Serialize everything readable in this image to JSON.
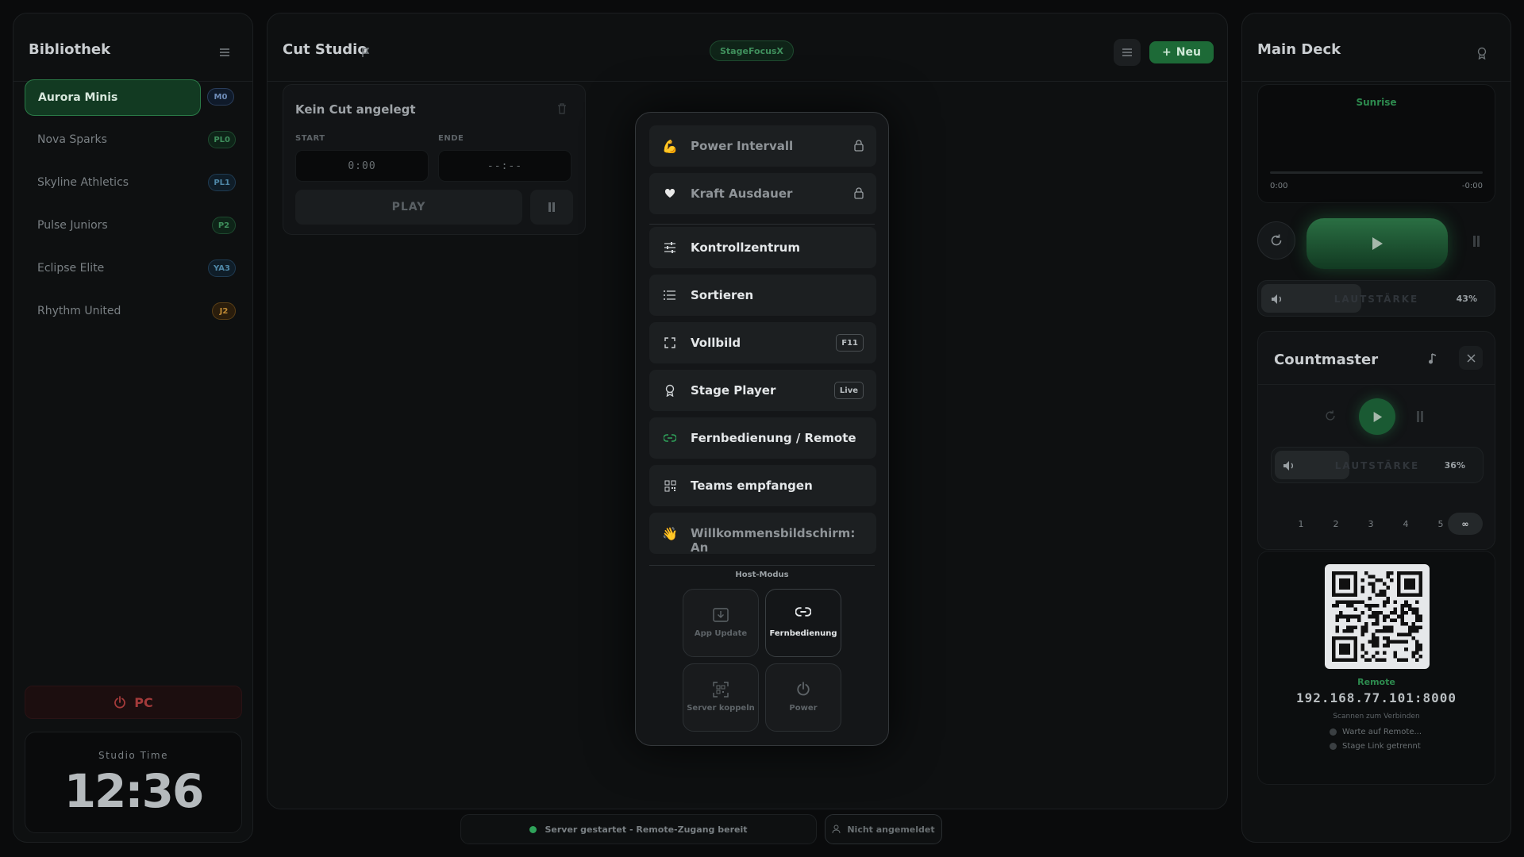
{
  "library": {
    "title": "Bibliothek",
    "items": [
      {
        "name": "Aurora Minis",
        "badge": "M0"
      },
      {
        "name": "Nova Sparks",
        "badge": "PL0"
      },
      {
        "name": "Skyline Athletics",
        "badge": "PL1"
      },
      {
        "name": "Pulse Juniors",
        "badge": "P2"
      },
      {
        "name": "Eclipse Elite",
        "badge": "YA3"
      },
      {
        "name": "Rhythm United",
        "badge": "J2"
      }
    ],
    "power_label": "PC",
    "studio_time_label": "Studio Time",
    "studio_time": "12:36"
  },
  "cut_studio": {
    "title": "Cut Studio",
    "tag": "StageFocusX",
    "new_button": "Neu",
    "card_title": "Kein Cut angelegt",
    "start_label": "START",
    "end_label": "ENDE",
    "start_value": "0:00",
    "end_value": "--:--",
    "play_label": "PLAY"
  },
  "menu": {
    "items": [
      {
        "label": "Power Intervall",
        "icon": "flexed-biceps-icon",
        "locked": true
      },
      {
        "label": "Kraft Ausdauer",
        "icon": "heart-icon",
        "locked": true
      },
      {
        "label": "Kontrollzentrum",
        "icon": "sliders-icon"
      },
      {
        "label": "Sortieren",
        "icon": "list-icon"
      },
      {
        "label": "Vollbild",
        "icon": "fullscreen-icon",
        "shortcut": "F11"
      },
      {
        "label": "Stage Player",
        "icon": "award-icon",
        "shortcut": "Live"
      },
      {
        "label": "Fernbedienung / Remote",
        "icon": "link-icon"
      },
      {
        "label": "Teams empfangen",
        "icon": "qr-icon"
      },
      {
        "label": "Willkommensbildschirm: An",
        "icon": "waving-hand-icon"
      }
    ],
    "host_mode_label": "Host-Modus",
    "host_buttons": [
      {
        "label": "App Update"
      },
      {
        "label": "Fernbedienung"
      },
      {
        "label": "Server koppeln"
      },
      {
        "label": "Power"
      }
    ]
  },
  "status": {
    "server": "Server gestartet - Remote-Zugang bereit",
    "login": "Nicht angemeldet"
  },
  "main_deck": {
    "title": "Main Deck",
    "track": "Sunrise",
    "time_start": "0:00",
    "time_end": "-0:00",
    "volume_label": "LAUTSTÄRKE",
    "volume": "43%",
    "volume_fraction": 0.43
  },
  "countmaster": {
    "title": "Countmaster",
    "volume_label": "LAUTSTÄRKE",
    "volume": "36%",
    "volume_fraction": 0.36,
    "steps": [
      "1",
      "2",
      "3",
      "4",
      "5",
      "∞"
    ]
  },
  "remote": {
    "label": "Remote",
    "ip": "192.168.77.101:8000",
    "scan_hint": "Scannen zum Verbinden",
    "status1": "Warte auf Remote...",
    "status2": "Stage Link getrennt"
  },
  "colors": {
    "accent": "#2fa35a",
    "danger": "#a33a3a"
  }
}
